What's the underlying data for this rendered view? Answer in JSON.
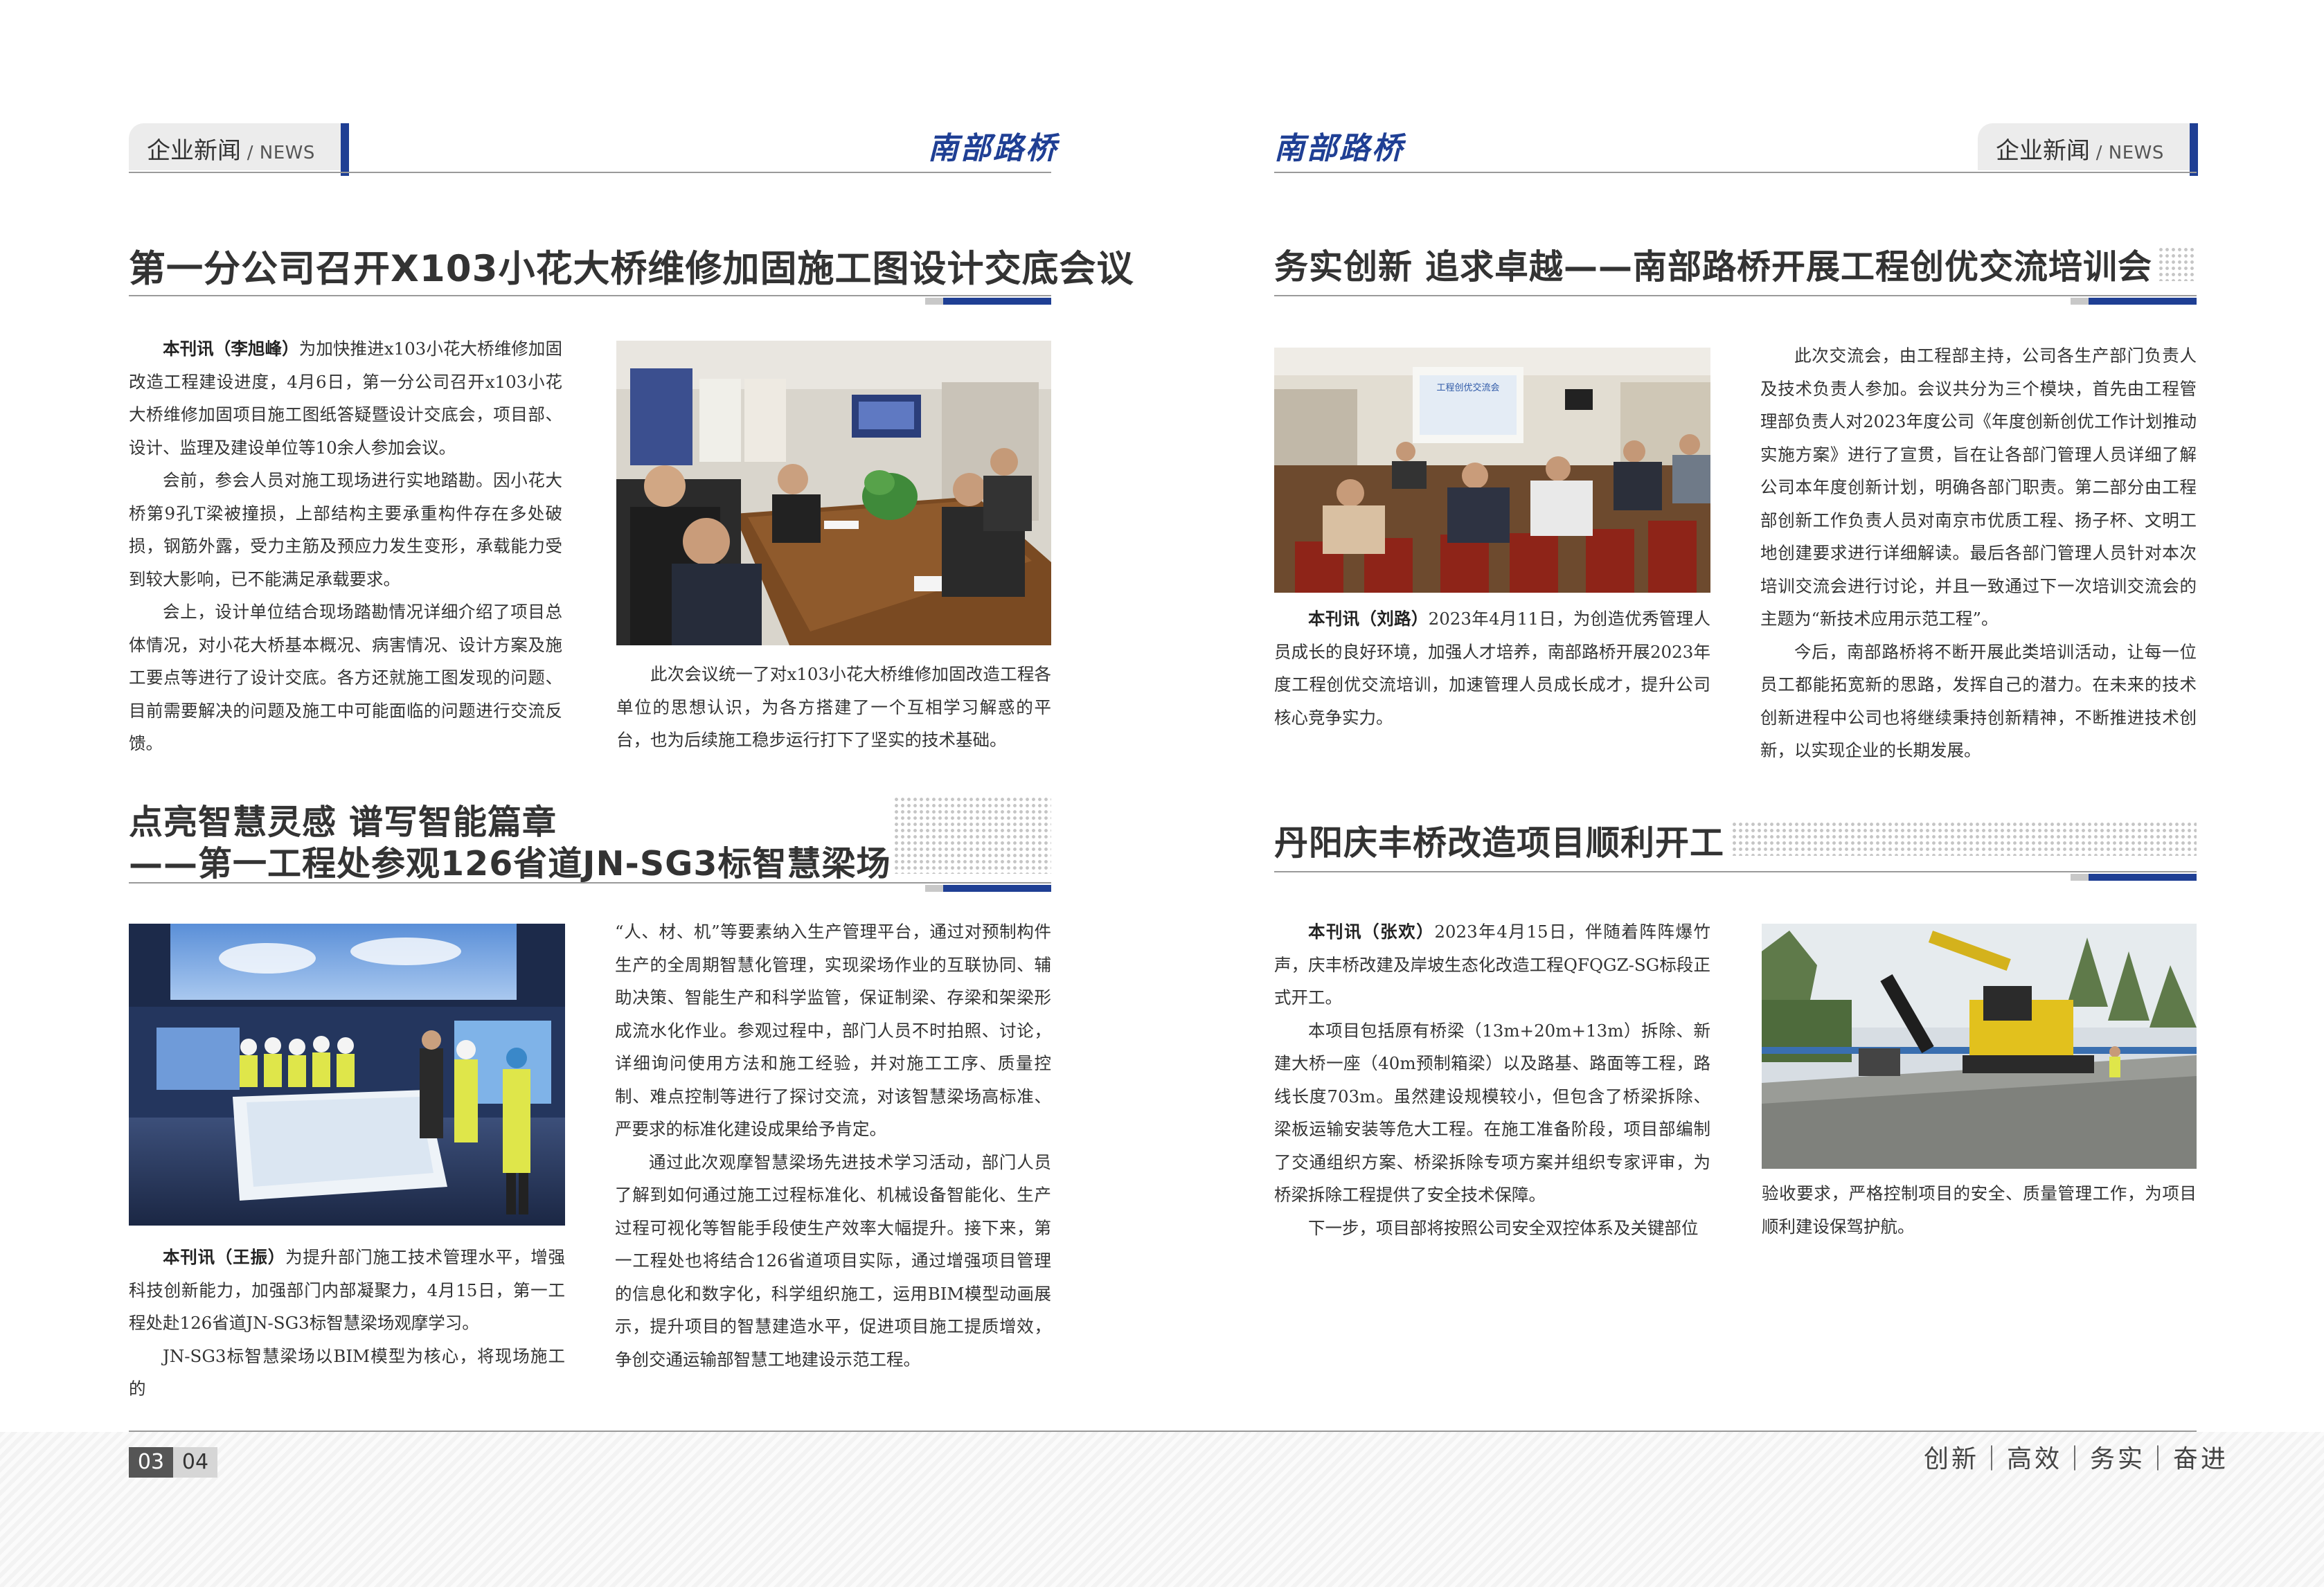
{
  "header": {
    "section_main": "企业新闻",
    "section_sep": " / ",
    "section_en": "NEWS",
    "brand": "南部路桥"
  },
  "articles": {
    "a1": {
      "title": "第一分公司召开X103小花大桥维修加固施工图设计交底会议",
      "lead_label": "本刊讯（李旭峰）",
      "lead": "为加快推进x103小花大桥维修加固改造工程建设进度，4月6日，第一分公司召开x103小花大桥维修加固项目施工图纸答疑暨设计交底会，项目部、设计、监理及建设单位等10余人参加会议。",
      "p2": "会前，参会人员对施工现场进行实地踏勘。因小花大桥第9孔T梁被撞损，上部结构主要承重构件存在多处破损，钢筋外露，受力主筋及预应力发生变形，承载能力受到较大影响，已不能满足承载要求。",
      "p3": "会上，设计单位结合现场踏勘情况详细介绍了项目总体情况，对小花大桥基本概况、病害情况、设计方案及施工要点等进行了设计交底。各方还就施工图发现的问题、目前需要解决的问题及施工中可能面临的问题进行交流反馈。",
      "p4": "此次会议统一了对x103小花大桥维修加固改造工程各单位的思想认识，为各方搭建了一个互相学习解惑的平台，也为后续施工稳步运行打下了坚实的技术基础。"
    },
    "a2": {
      "title_line1": "点亮智慧灵感 谱写智能篇章",
      "title_line2": "——第一工程处参观126省道JN-SG3标智慧梁场",
      "lead_label": "本刊讯（王振）",
      "lead": "为提升部门施工技术管理水平，增强科技创新能力，加强部门内部凝聚力，4月15日，第一工程处赴126省道JN-SG3标智慧梁场观摩学习。",
      "p2_start": "JN-SG3标智慧梁场以BIM模型为核心，将现场施工的",
      "p2_cont": "“人、材、机”等要素纳入生产管理平台，通过对预制构件生产的全周期智慧化管理，实现梁场作业的互联协同、辅助决策、智能生产和科学监管，保证制梁、存梁和架梁形成流水化作业。参观过程中，部门人员不时拍照、讨论，详细询问使用方法和施工经验，并对施工工序、质量控制、难点控制等进行了探讨交流，对该智慧梁场高标准、严要求的标准化建设成果给予肯定。",
      "p3": "通过此次观摩智慧梁场先进技术学习活动，部门人员了解到如何通过施工过程标准化、机械设备智能化、生产过程可视化等智能手段使生产效率大幅提升。接下来，第一工程处也将结合126省道项目实际，通过增强项目管理的信息化和数字化，科学组织施工，运用BIM模型动画展示，提升项目的智慧建造水平，促进项目施工提质增效，争创交通运输部智慧工地建设示范工程。"
    },
    "a3": {
      "title": "务实创新 追求卓越——南部路桥开展工程创优交流培训会",
      "lead_label": "本刊讯（刘路）",
      "lead": "2023年4月11日，为创造优秀管理人员成长的良好环境，加强人才培养，南部路桥开展2023年度工程创优交流培训，加速管理人员成长成才，提升公司核心竞争实力。",
      "p2": "此次交流会，由工程部主持，公司各生产部门负责人及技术负责人参加。会议共分为三个模块，首先由工程管理部负责人对2023年度公司《年度创新创优工作计划推动实施方案》进行了宣贯，旨在让各部门管理人员详细了解公司本年度创新计划，明确各部门职责。第二部分由工程部创新工作负责人员对南京市优质工程、扬子杯、文明工地创建要求进行详细解读。最后各部门管理人员针对本次培训交流会进行讨论，并且一致通过下一次培训交流会的主题为“新技术应用示范工程”。",
      "p3": "今后，南部路桥将不断开展此类培训活动，让每一位员工都能拓宽新的思路，发挥自己的潜力。在未来的技术创新进程中公司也将继续秉持创新精神，不断推进技术创新，以实现企业的长期发展。",
      "screen_text": "工程创优交流会"
    },
    "a4": {
      "title": "丹阳庆丰桥改造项目顺利开工",
      "lead_label": "本刊讯（张欢）",
      "lead": "2023年4月15日，伴随着阵阵爆竹声，庆丰桥改建及岸坡生态化改造工程QFQGZ-SG标段正式开工。",
      "p2": "本项目包括原有桥梁（13m+20m+13m）拆除、新建大桥一座（40m预制箱梁）以及路基、路面等工程，路线长度703m。虽然建设规模较小，但包含了桥梁拆除、梁板运输安装等危大工程。在施工准备阶段，项目部编制了交通组织方案、桥梁拆除专项方案并组织专家评审，为桥梁拆除工程提供了安全技术保障。",
      "p3_start": "下一步，项目部将按照公司安全双控体系及关键部位",
      "p3_cont": "验收要求，严格控制项目的安全、质量管理工作，为项目顺利建设保驾护航。"
    }
  },
  "footer": {
    "page_left": "03",
    "page_right": "04",
    "slogan": "创新｜高效｜务实｜奋进"
  },
  "colors": {
    "accent": "#1f3f94",
    "rule": "#9a9a9a",
    "tab_bg": "#ececec"
  }
}
